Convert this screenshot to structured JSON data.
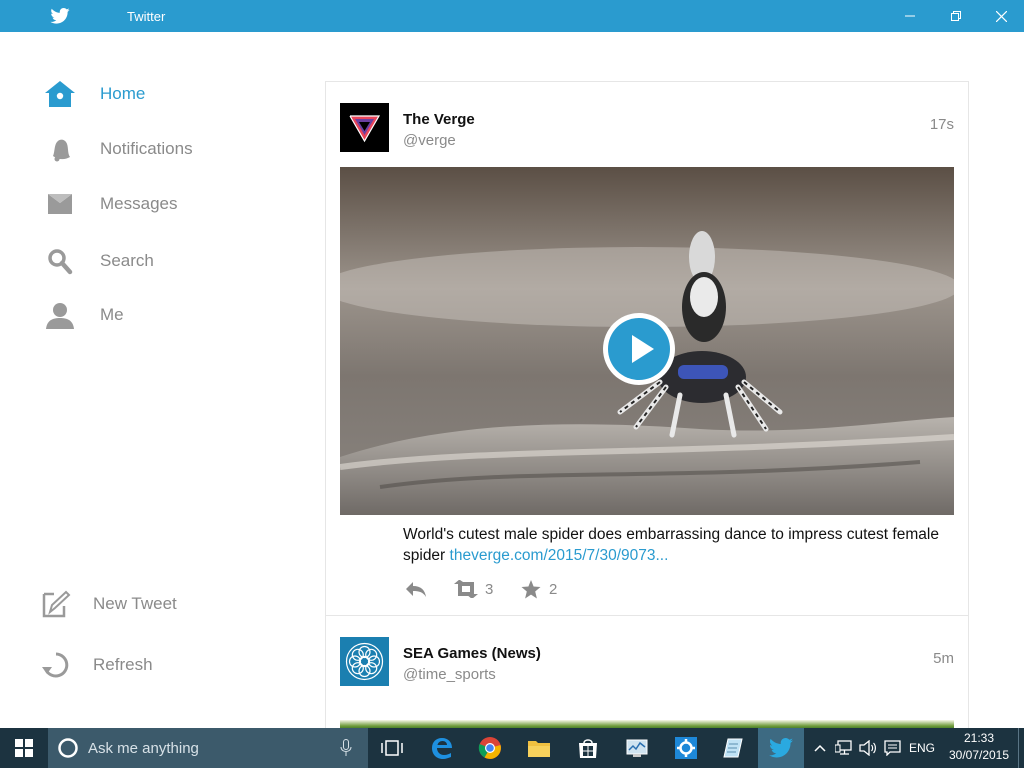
{
  "window": {
    "title": "Twitter"
  },
  "sidebar": {
    "items": [
      {
        "label": "Home",
        "icon": "home-icon",
        "active": true
      },
      {
        "label": "Notifications",
        "icon": "bell-icon"
      },
      {
        "label": "Messages",
        "icon": "envelope-icon"
      },
      {
        "label": "Search",
        "icon": "search-icon"
      },
      {
        "label": "Me",
        "icon": "person-icon"
      }
    ],
    "actions": [
      {
        "label": "New Tweet",
        "icon": "compose-icon"
      },
      {
        "label": "Refresh",
        "icon": "refresh-icon"
      }
    ]
  },
  "feed": {
    "tweets": [
      {
        "name": "The Verge",
        "handle": "@verge",
        "time": "17s",
        "text": "World's cutest male spider does embarrassing dance to impress cutest female spider",
        "link": "theverge.com/2015/7/30/9073...",
        "retweets": "3",
        "favorites": "2",
        "media": "video-thumbnail"
      },
      {
        "name": "SEA Games (News)",
        "handle": "@time_sports",
        "time": "5m"
      }
    ]
  },
  "taskbar": {
    "search_placeholder": "Ask me anything",
    "language": "ENG",
    "time": "21:33",
    "date": "30/07/2015"
  },
  "colors": {
    "accent": "#2a9bcf",
    "taskbar": "#1c3340",
    "muted": "#8a8a8a"
  }
}
